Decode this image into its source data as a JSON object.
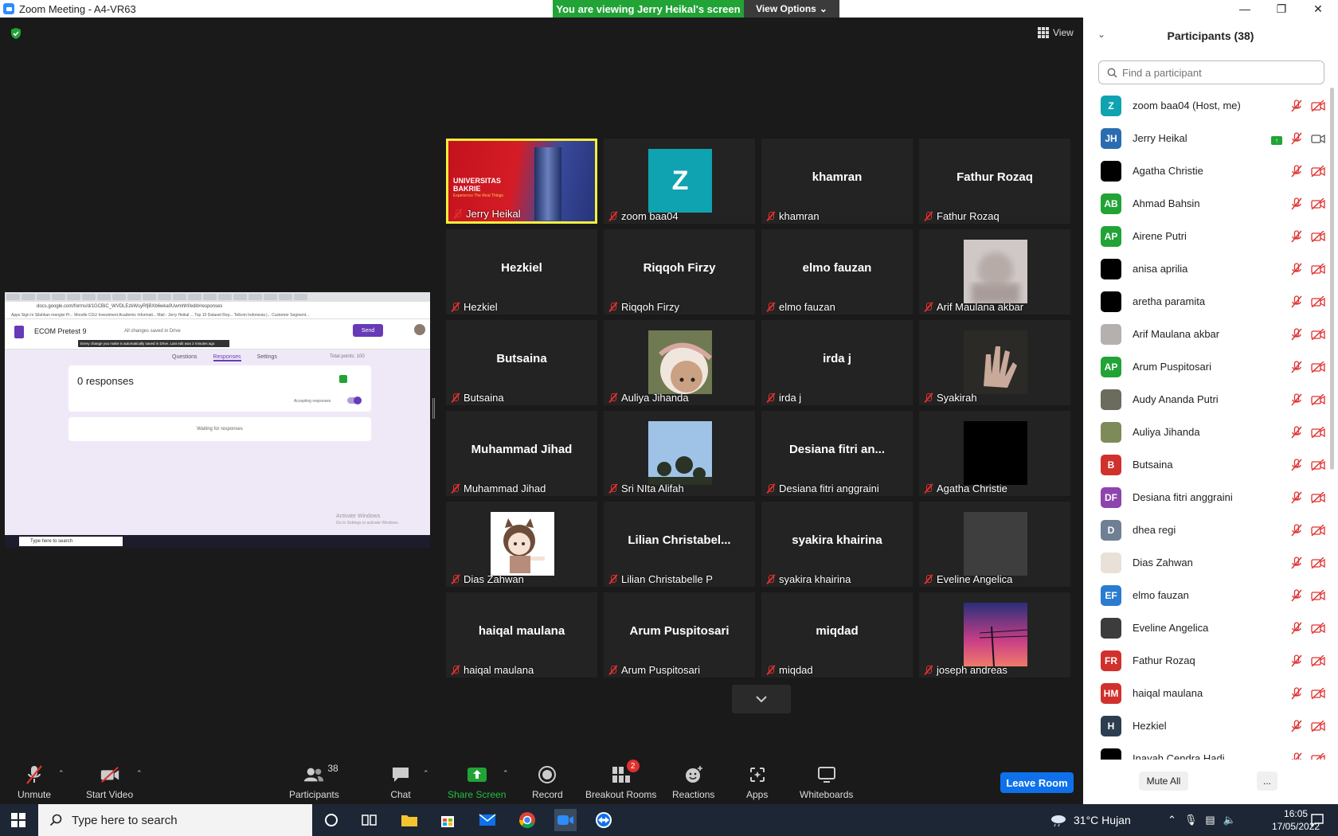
{
  "window": {
    "title": "Zoom Meeting - A4-VR63",
    "viewing_banner": "You are viewing Jerry Heikal's screen",
    "view_options": "View Options",
    "view_label": "View"
  },
  "shared_screen": {
    "form_title": "ECOM Pretest 9",
    "saved_text": "All changes saved in Drive",
    "tooltip": "Every change you make is automatically saved in Drive. Last edit was 2 minutes ago",
    "address": "docs.google.com/forms/d/1GCBiC_WVDLEzkWsyRfjBXb6wka0Uwmhhf/edit#responses",
    "bookmarks": "Apps   Sign In   Silahkan mengisi Pr...   Moodle CGU   Investment   Academic Informati...   Mail - Jerry Heikal ...   Top 10 Dataset Rep...   Telkom Indonesia |...   Customer Segment...",
    "send": "Send",
    "tabs": [
      "Questions",
      "Responses",
      "Settings"
    ],
    "total_points": "Total points: 100",
    "responses": "0 responses",
    "accepting": "Accepting responses",
    "waiting": "Waiting for responses",
    "activate": "Activate Windows",
    "activate_sub": "Go to Settings to activate Windows.",
    "taskbar_search": "Type here to search",
    "accepting_on": true
  },
  "tiles": [
    {
      "label": "Jerry Heikal",
      "kind": "slide",
      "slide_title": "UNIVERSITAS BAKRIE",
      "slide_sub": "Experience The Real Things"
    },
    {
      "label": "zoom baa04",
      "kind": "avatar",
      "letter": "Z"
    },
    {
      "label": "khamran",
      "kind": "name",
      "center": "khamran"
    },
    {
      "label": "Fathur Rozaq",
      "kind": "name",
      "center": "Fathur Rozaq"
    },
    {
      "label": "Hezkiel",
      "kind": "name",
      "center": "Hezkiel"
    },
    {
      "label": "Riqqoh Firzy",
      "kind": "name",
      "center": "Riqqoh Firzy"
    },
    {
      "label": "elmo fauzan",
      "kind": "name",
      "center": "elmo fauzan"
    },
    {
      "label": "Arif Maulana akbar",
      "kind": "photo",
      "photo": "blur"
    },
    {
      "label": "Butsaina",
      "kind": "name",
      "center": "Butsaina"
    },
    {
      "label": "Auliya Jihanda",
      "kind": "photo",
      "photo": "hijab"
    },
    {
      "label": "irda j",
      "kind": "name",
      "center": "irda j"
    },
    {
      "label": "Syakirah",
      "kind": "photo",
      "photo": "hand"
    },
    {
      "label": "Muhammad Jihad",
      "kind": "name",
      "center": "Muhammad Jihad"
    },
    {
      "label": "Sri NIta Alifah",
      "kind": "photo",
      "photo": "sky"
    },
    {
      "label": "Desiana fitri anggraini",
      "kind": "name",
      "center": "Desiana fitri an..."
    },
    {
      "label": "Agatha Christie",
      "kind": "photo",
      "photo": "black"
    },
    {
      "label": "Dias Zahwan",
      "kind": "photo",
      "photo": "cartoon"
    },
    {
      "label": "Lilian Christabelle P",
      "kind": "name",
      "center": "Lilian  Christabel..."
    },
    {
      "label": "syakira khairina",
      "kind": "name",
      "center": "syakira khairina"
    },
    {
      "label": "Eveline Angelica",
      "kind": "photo",
      "photo": "grey"
    },
    {
      "label": "haiqal maulana",
      "kind": "name",
      "center": "haiqal maulana"
    },
    {
      "label": "Arum Puspitosari",
      "kind": "name",
      "center": "Arum Puspitosari"
    },
    {
      "label": "miqdad",
      "kind": "name",
      "center": "miqdad"
    },
    {
      "label": "joseph andreas",
      "kind": "photo",
      "photo": "sunset"
    }
  ],
  "toolbar": {
    "unmute": "Unmute",
    "start_video": "Start Video",
    "participants": "Participants",
    "participants_count": "38",
    "chat": "Chat",
    "share_screen": "Share Screen",
    "record": "Record",
    "breakout": "Breakout Rooms",
    "breakout_badge": "2",
    "reactions": "Reactions",
    "apps": "Apps",
    "whiteboards": "Whiteboards",
    "leave": "Leave Room"
  },
  "panel": {
    "title": "Participants (38)",
    "search_placeholder": "Find a participant",
    "mute_all": "Mute All",
    "more": "...",
    "participants": [
      {
        "name": "zoom baa04 (Host, me)",
        "initials": "Z",
        "color": "#0fa3b1"
      },
      {
        "name": "Jerry Heikal",
        "initials": "JH",
        "color": "#2b6cb0",
        "sharing": true,
        "video_on": true
      },
      {
        "name": "Agatha Christie",
        "initials": "",
        "color": "#000000"
      },
      {
        "name": "Ahmad Bahsin",
        "initials": "AB",
        "color": "#21a336"
      },
      {
        "name": "Airene Putri",
        "initials": "AP",
        "color": "#21a336"
      },
      {
        "name": "anisa aprilia",
        "initials": "",
        "color": "#000000"
      },
      {
        "name": "aretha paramita",
        "initials": "",
        "color": "#000000"
      },
      {
        "name": "Arif Maulana akbar",
        "initials": "",
        "color": "#b5b0ae"
      },
      {
        "name": "Arum Puspitosari",
        "initials": "AP",
        "color": "#21a336"
      },
      {
        "name": "Audy Ananda Putri",
        "initials": "",
        "color": "#6b6b5e"
      },
      {
        "name": "Auliya Jihanda",
        "initials": "",
        "color": "#7d8a5a"
      },
      {
        "name": "Butsaina",
        "initials": "B",
        "color": "#d0312d"
      },
      {
        "name": "Desiana fitri anggraini",
        "initials": "DF",
        "color": "#8e44ad"
      },
      {
        "name": "dhea regi",
        "initials": "D",
        "color": "#6f7f94"
      },
      {
        "name": "Dias Zahwan",
        "initials": "",
        "color": "#e9e0d8"
      },
      {
        "name": "elmo fauzan",
        "initials": "EF",
        "color": "#2b7bd1"
      },
      {
        "name": "Eveline Angelica",
        "initials": "",
        "color": "#3c3c3c"
      },
      {
        "name": "Fathur Rozaq",
        "initials": "FR",
        "color": "#d0312d"
      },
      {
        "name": "haiqal maulana",
        "initials": "HM",
        "color": "#d0312d"
      },
      {
        "name": "Hezkiel",
        "initials": "H",
        "color": "#2c3e50"
      },
      {
        "name": "Inayah Cendra Hadi",
        "initials": "",
        "color": "#000000"
      }
    ]
  },
  "taskbar": {
    "search": "Type here to search",
    "weather": "31°C  Hujan",
    "time": "16:05",
    "date": "17/05/2022"
  },
  "colors": {
    "accent": "#0e71eb",
    "green": "#21a336",
    "mute_red": "#e0302f",
    "speaker_border": "#f2ef3d"
  }
}
